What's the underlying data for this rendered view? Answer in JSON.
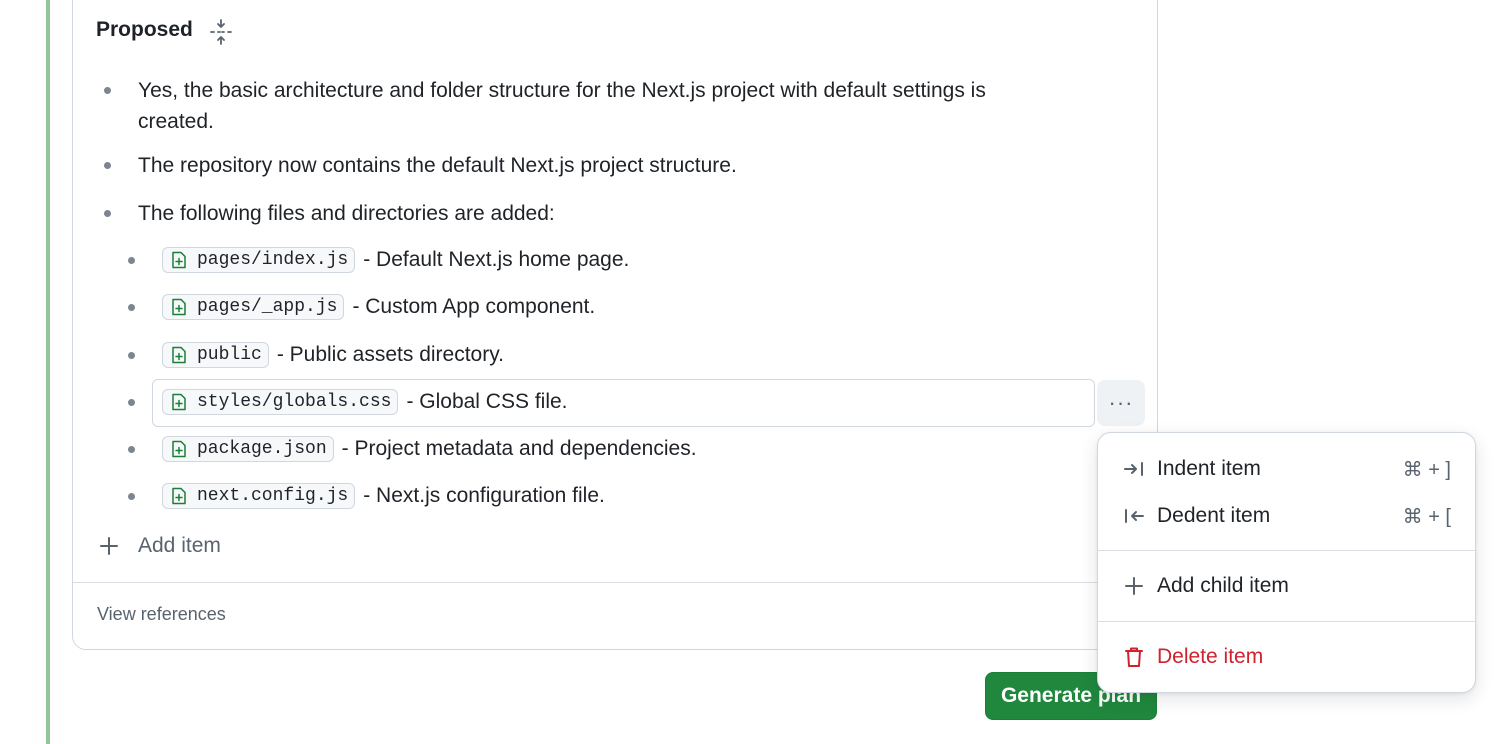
{
  "card": {
    "title": "Proposed",
    "items": [
      {
        "text": "Yes, the basic architecture and folder structure for the Next.js project with default settings is created."
      },
      {
        "text": "The repository now contains the default Next.js project structure."
      },
      {
        "text": "The following files and directories are added:"
      }
    ],
    "children": [
      {
        "file": "pages/index.js",
        "desc": "- Default Next.js home page."
      },
      {
        "file": "pages/_app.js",
        "desc": "- Custom App component."
      },
      {
        "file": "public",
        "desc": "- Public assets directory."
      },
      {
        "file": "styles/globals.css",
        "desc": "- Global CSS file."
      },
      {
        "file": "package.json",
        "desc": "- Project metadata and dependencies."
      },
      {
        "file": "next.config.js",
        "desc": "- Next.js configuration file."
      }
    ],
    "add_item_label": "Add item",
    "view_references_label": "View references",
    "more_button_label": "···"
  },
  "generate_button_label": "Generate plan",
  "context_menu": {
    "items": [
      {
        "label": "Indent item",
        "shortcut": "⌘ + ]",
        "icon": "indent-icon"
      },
      {
        "label": "Dedent item",
        "shortcut": "⌘ + [",
        "icon": "dedent-icon"
      },
      {
        "label": "Add child item",
        "icon": "plus-icon"
      },
      {
        "label": "Delete item",
        "icon": "trash-icon"
      }
    ]
  },
  "colors": {
    "accent_green": "#1f883d",
    "danger_red": "#cf222e",
    "file_icon_green": "#1a7f37",
    "left_bar_green": "#8fc79a"
  }
}
